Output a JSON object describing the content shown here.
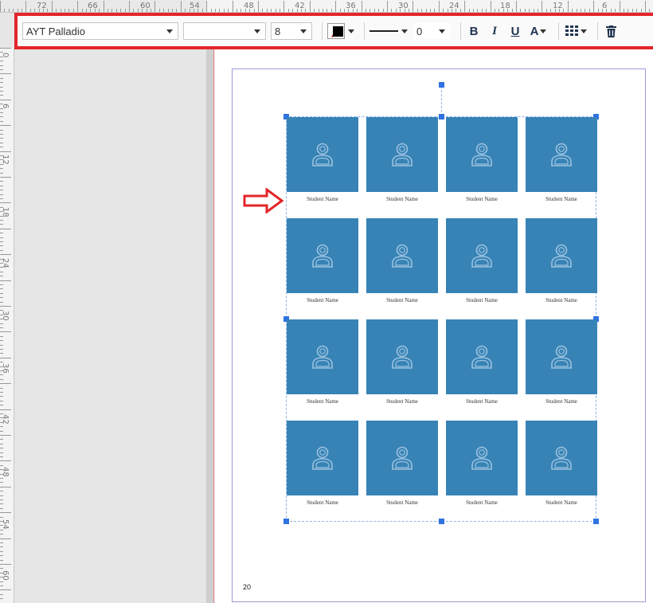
{
  "ruler": {
    "top_labels": [
      "72",
      "66",
      "60",
      "54",
      "48",
      "42",
      "36",
      "30",
      "24",
      "18",
      "12",
      "6"
    ],
    "left_labels": [
      "0",
      "6",
      "12",
      "18",
      "24",
      "30",
      "36",
      "42",
      "48",
      "54",
      "60"
    ]
  },
  "toolbar": {
    "font_family": "AYT Palladio",
    "font_style": "",
    "font_size": "8",
    "fill_color": "#000000",
    "line_width": "0",
    "bold_label": "B",
    "italic_label": "I",
    "underline_label": "U",
    "text_color_label": "A"
  },
  "page": {
    "number": "20",
    "grid": [
      [
        "Student Name",
        "Student Name",
        "Student Name",
        "Student Name"
      ],
      [
        "Student Name",
        "Student Name",
        "Student Name",
        "Student Name"
      ],
      [
        "Student Name",
        "Student Name",
        "Student Name",
        "Student Name"
      ],
      [
        "Student Name",
        "Student Name",
        "Student Name",
        "Student Name"
      ]
    ]
  },
  "colors": {
    "accent_highlight": "#e3252a",
    "photo_placeholder": "#3783b6",
    "selection_handle": "#2f73e0"
  },
  "icons": {
    "placeholder": "person-icon",
    "grid": "grid-icon",
    "delete": "trash-icon"
  }
}
